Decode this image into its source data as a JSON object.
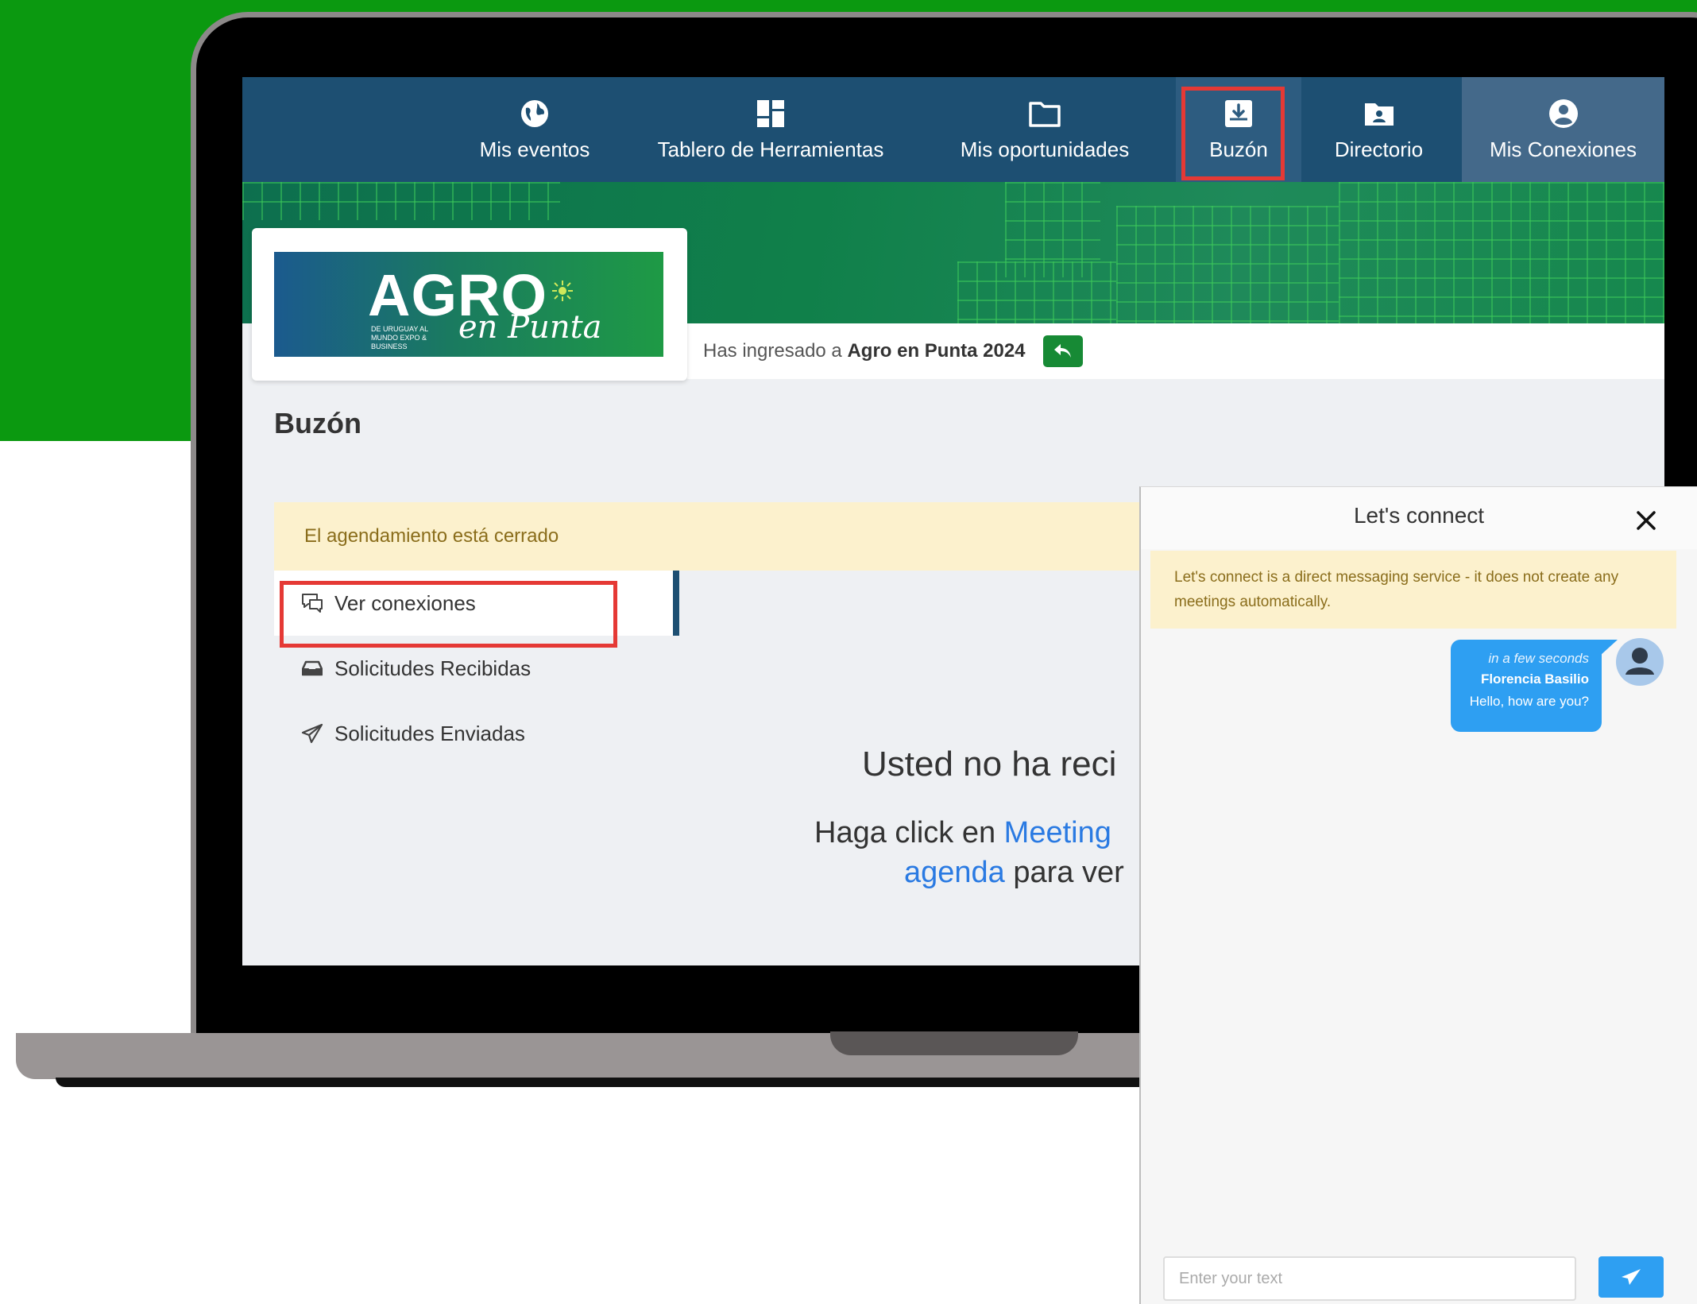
{
  "nav": {
    "items": [
      {
        "label": "Mis eventos",
        "icon": "globe-icon"
      },
      {
        "label": "Tablero de Herramientas",
        "icon": "dashboard-icon"
      },
      {
        "label": "Mis oportunidades",
        "icon": "folder-icon"
      },
      {
        "label": "Buzón",
        "icon": "inbox-download-icon"
      },
      {
        "label": "Directorio",
        "icon": "contact-folder-icon"
      },
      {
        "label": "Mis Conexiones",
        "icon": "user-circle-icon"
      }
    ]
  },
  "logo": {
    "brand": "AGRO",
    "script": "en Punta",
    "tagline": "DE URUGUAY AL MUNDO EXPO & BUSINESS"
  },
  "event_info": {
    "prefix": "Has ingresado a ",
    "event_name": "Agro en Punta 2024"
  },
  "page": {
    "title": "Buzón",
    "alert": "El agendamiento está cerrado"
  },
  "side_menu": {
    "items": [
      {
        "label": "Ver conexiones",
        "icon": "chat-bubbles-icon"
      },
      {
        "label": "Solicitudes Recibidas",
        "icon": "inbox-tray-icon"
      },
      {
        "label": "Solicitudes Enviadas",
        "icon": "paper-plane-icon"
      }
    ]
  },
  "empty_state": {
    "title": "Usted no ha reci",
    "line1_prefix": "Haga click en ",
    "line1_link": "Meeting",
    "line2_link": "agenda",
    "line2_suffix": " para ver"
  },
  "chat": {
    "title": "Let's connect",
    "notice": "Let's connect is a direct messaging service - it does not create any meetings automatically.",
    "message": {
      "time": "in a few seconds",
      "sender": "Florencia Basilio",
      "text": "Hello, how are you?"
    },
    "input_placeholder": "Enter your text"
  },
  "colors": {
    "navbar": "#1d4f72",
    "highlight": "#e53935",
    "alert_bg": "#fcf1cd",
    "link": "#2a7ae2",
    "bubble": "#2e9ff2",
    "page_green": "#0b9910"
  }
}
